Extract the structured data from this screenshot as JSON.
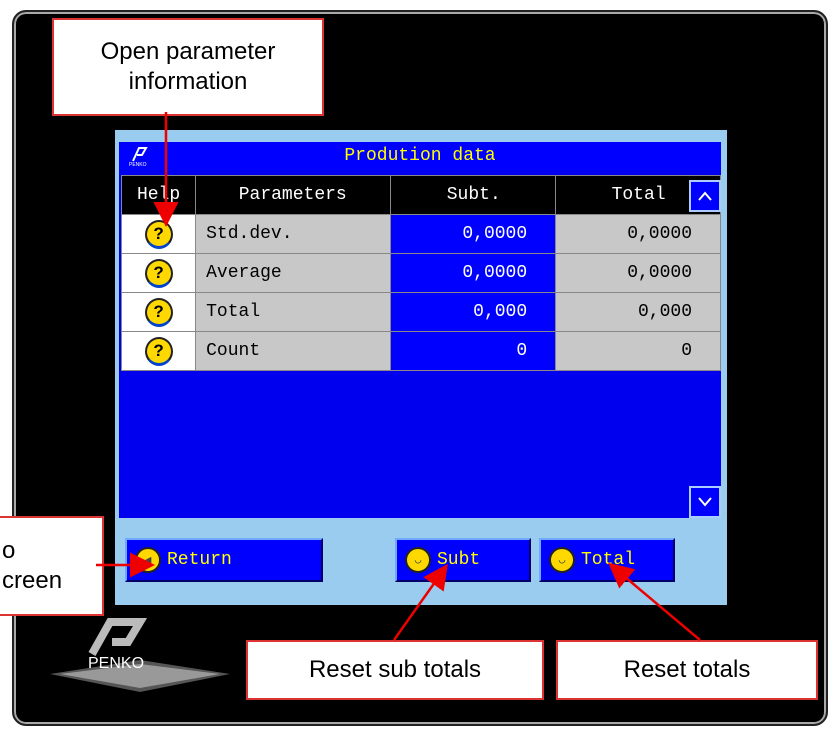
{
  "window": {
    "title": "Prodution data"
  },
  "table": {
    "headers": {
      "help": "Help",
      "parameters": "Parameters",
      "subt": "Subt.",
      "total": "Total"
    },
    "rows": [
      {
        "param": "Std.dev.",
        "subt": "0,0000",
        "total": "0,0000"
      },
      {
        "param": "Average",
        "subt": "0,0000",
        "total": "0,0000"
      },
      {
        "param": "Total",
        "subt": "0,000",
        "total": "0,000"
      },
      {
        "param": "Count",
        "subt": "0",
        "total": "0"
      }
    ],
    "help_icon_label": "?"
  },
  "buttons": {
    "return": "Return",
    "subt": "Subt",
    "total": "Total"
  },
  "callouts": {
    "open_param_info": "Open parameter information",
    "left_partial": "o\ncreen",
    "reset_sub_totals": "Reset sub totals",
    "reset_totals": "Reset totals"
  },
  "logo": {
    "text": "PENKO"
  },
  "colors": {
    "panel": "#0000ee",
    "title_text": "#ffff00",
    "screen_bg": "#99ccee",
    "callout_border": "#dd3333"
  }
}
